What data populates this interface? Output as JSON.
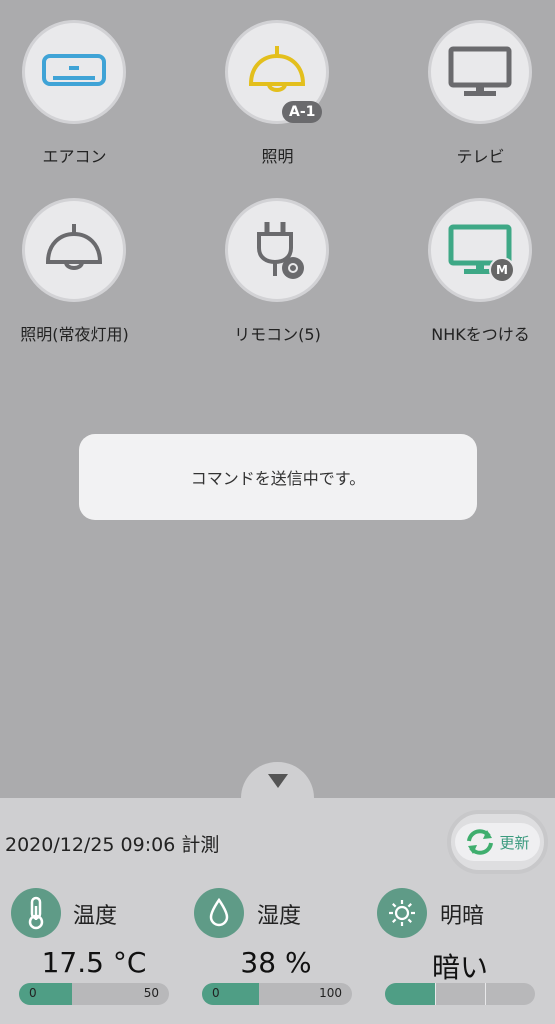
{
  "devices": [
    {
      "label": "エアコン",
      "icon": "air-conditioner-icon"
    },
    {
      "label": "照明",
      "icon": "ceiling-lamp-icon",
      "badge": "A-1"
    },
    {
      "label": "テレビ",
      "icon": "tv-icon"
    },
    {
      "label": "照明(常夜灯用)",
      "icon": "ceiling-lamp-icon"
    },
    {
      "label": "リモコン(5)",
      "icon": "plug-icon"
    },
    {
      "label": "NHKをつける",
      "icon": "tv-icon",
      "badge": "M"
    }
  ],
  "toast": {
    "message": "コマンドを送信中です。"
  },
  "panel": {
    "collapse_icon": "triangle-down-icon",
    "measured": "2020/12/25 09:06 計測",
    "refresh_label": "更新"
  },
  "sensors": {
    "temperature": {
      "name": "温度",
      "value": "17.5 °C",
      "min": "0",
      "max": "50",
      "level": 17.5,
      "range": [
        0,
        50
      ]
    },
    "humidity": {
      "name": "湿度",
      "value": "38 %",
      "min": "0",
      "max": "100",
      "level": 38,
      "range": [
        0,
        100
      ]
    },
    "brightness": {
      "name": "明暗",
      "value": "暗い",
      "level_fraction": 0.33
    }
  },
  "colors": {
    "accent": "#4f9e85",
    "ac_blue": "#3fa3d6",
    "lamp_yellow": "#e3bf1d",
    "tv_green": "#3ea886",
    "icon_gray": "#6a6a6d"
  }
}
